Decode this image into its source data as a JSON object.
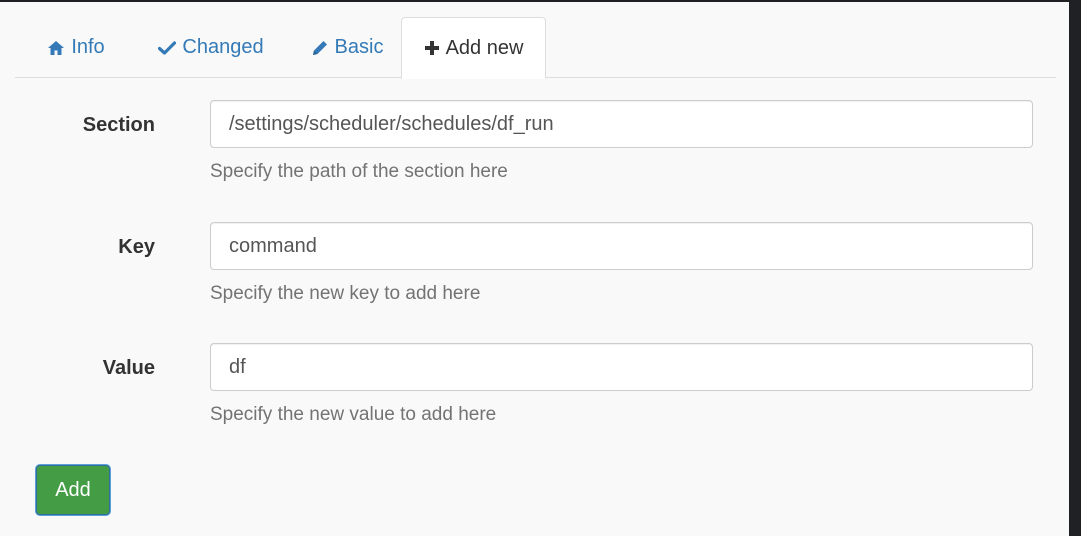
{
  "tabs": [
    {
      "label": "Info",
      "icon": "home-icon",
      "active": false
    },
    {
      "label": "Changed",
      "icon": "check-icon",
      "active": false
    },
    {
      "label": "Basic",
      "icon": "pencil-icon",
      "active": false
    },
    {
      "label": "Add new",
      "icon": "plus-icon",
      "active": true
    }
  ],
  "form": {
    "section": {
      "label": "Section",
      "value": "/settings/scheduler/schedules/df_run",
      "help": "Specify the path of the section here"
    },
    "key": {
      "label": "Key",
      "value": "command",
      "help": "Specify the new key to add here"
    },
    "value": {
      "label": "Value",
      "value": "df",
      "help": "Specify the new value to add here"
    },
    "submit_label": "Add"
  },
  "colors": {
    "link": "#337ab7",
    "success": "#449d44",
    "background": "#f9f9f9",
    "outer": "#202124"
  }
}
